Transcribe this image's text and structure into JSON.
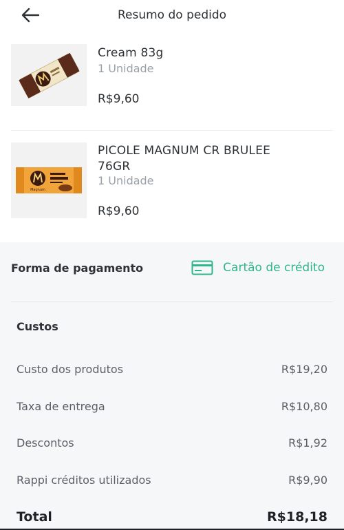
{
  "header": {
    "title": "Resumo do pedido"
  },
  "items": [
    {
      "name_lines": [
        "Cream 83g"
      ],
      "quantity": "1 Unidade",
      "price": "R$9,60"
    },
    {
      "name_lines": [
        "PICOLE MAGNUM CR BRULEE",
        "76GR"
      ],
      "quantity": "1 Unidade",
      "price": "R$9,60",
      "package_text": "Magnum"
    }
  ],
  "payment": {
    "label": "Forma de pagamento",
    "method": "Cartão de crédito",
    "accent": "#2fb58a"
  },
  "costs": {
    "title": "Custos",
    "rows": [
      {
        "label": "Custo dos produtos",
        "value": "R$19,20"
      },
      {
        "label": "Taxa de entrega",
        "value": "R$10,80"
      },
      {
        "label": "Descontos",
        "value": "R$1,92"
      },
      {
        "label": "Rappi créditos utilizados",
        "value": "R$9,90"
      }
    ],
    "total_label": "Total",
    "total_value": "R$18,18"
  }
}
